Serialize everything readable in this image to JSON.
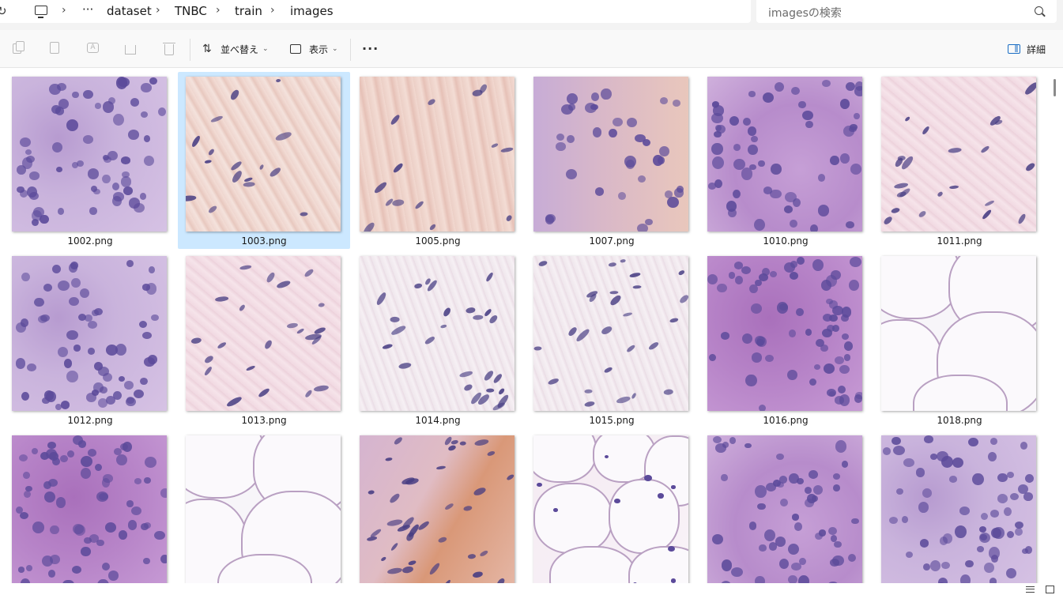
{
  "address_bar": {
    "breadcrumb": [
      "dataset",
      "TNBC",
      "train",
      "images"
    ],
    "overflow_label": "···",
    "separator": "›",
    "search_placeholder": "imagesの検索"
  },
  "command_bar": {
    "sort_label": "並べ替え",
    "view_label": "表示",
    "more_label": "···",
    "details_label": "詳細"
  },
  "files": [
    {
      "name": "1002.png",
      "tissue": "dense",
      "selected": false
    },
    {
      "name": "1003.png",
      "tissue": "stroma",
      "selected": true
    },
    {
      "name": "1005.png",
      "tissue": "pinkst",
      "selected": false
    },
    {
      "name": "1007.png",
      "tissue": "mixed",
      "selected": false
    },
    {
      "name": "1010.png",
      "tissue": "purple",
      "selected": false
    },
    {
      "name": "1011.png",
      "tissue": "lightpk",
      "selected": false
    },
    {
      "name": "1012.png",
      "tissue": "dense",
      "selected": false
    },
    {
      "name": "1013.png",
      "tissue": "lightpk",
      "selected": false
    },
    {
      "name": "1014.png",
      "tissue": "pale",
      "selected": false
    },
    {
      "name": "1015.png",
      "tissue": "pale",
      "selected": false
    },
    {
      "name": "1016.png",
      "tissue": "deep",
      "selected": false
    },
    {
      "name": "1018.png",
      "tissue": "fat",
      "selected": false
    },
    {
      "name": "",
      "tissue": "deep",
      "selected": false
    },
    {
      "name": "",
      "tissue": "fat",
      "selected": false
    },
    {
      "name": "",
      "tissue": "orange",
      "selected": false
    },
    {
      "name": "",
      "tissue": "fatcell",
      "selected": false
    },
    {
      "name": "",
      "tissue": "purple",
      "selected": false
    },
    {
      "name": "",
      "tissue": "dense",
      "selected": false
    }
  ],
  "colors": {
    "selection": "#cce8ff",
    "accent": "#1a6dc4",
    "nucleus": "#5b4a9a"
  }
}
